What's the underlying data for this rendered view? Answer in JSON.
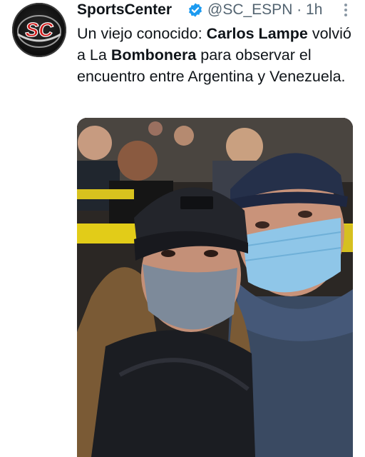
{
  "tweet": {
    "display_name": "SportsCenter",
    "handle": "@SC_ESPN",
    "separator": "·",
    "time": "1h",
    "avatar_text": "SC",
    "text_1": "Un viejo conocido: ",
    "text_bold_1": "Carlos Lampe",
    "text_2": " volvió a La ",
    "text_bold_2": "Bombonera",
    "text_3": " para observar el encuentro entre Argentina y Venezuela.",
    "media_icon": "photo-stadium-fans"
  },
  "colors": {
    "text": "#0f1419",
    "secondary": "#536471",
    "verified": "#1d9bf0",
    "avatar_red": "#d11a1a"
  }
}
